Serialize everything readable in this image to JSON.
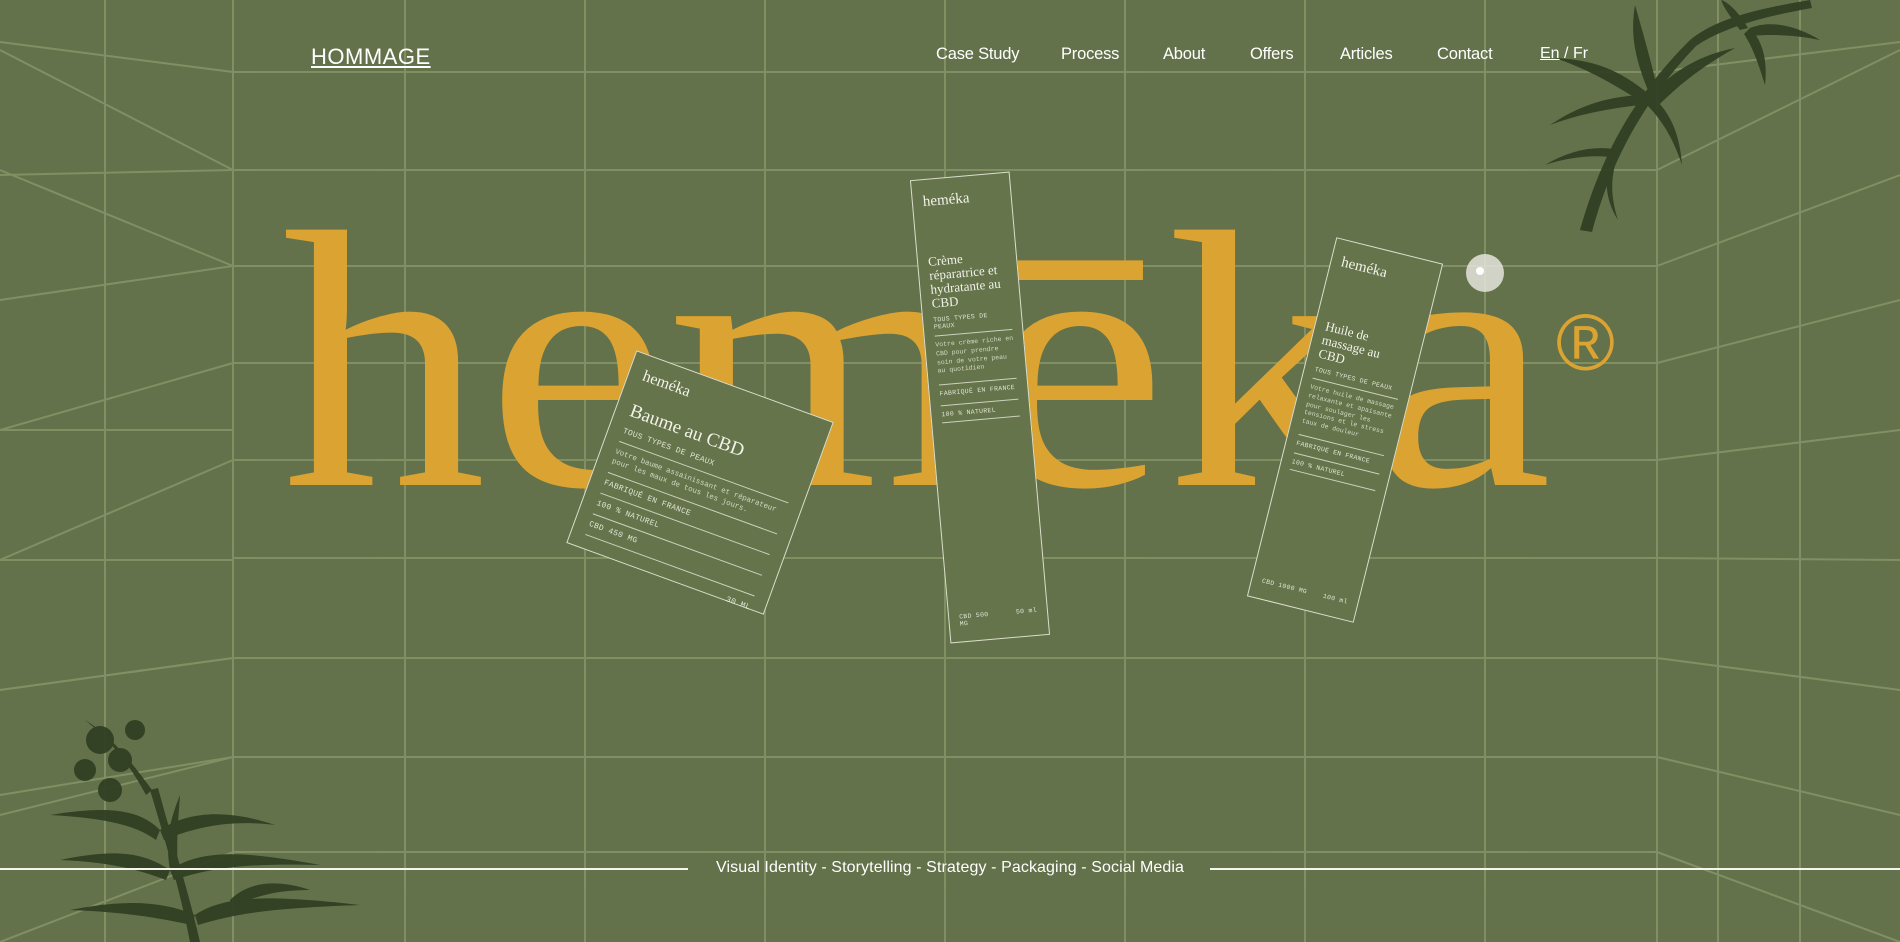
{
  "header": {
    "logo": "HOMMAGE",
    "nav": [
      {
        "label": "Case Study"
      },
      {
        "label": "Process"
      },
      {
        "label": "About"
      },
      {
        "label": "Offers"
      },
      {
        "label": "Articles"
      },
      {
        "label": "Contact"
      }
    ],
    "language": {
      "active": "En",
      "separator": "/",
      "other": "Fr"
    }
  },
  "hero": {
    "wordmark": "hemēka",
    "registered": "®",
    "accent_color": "#dba331",
    "background_color": "#63724a",
    "products": [
      {
        "brand": "heméka",
        "name": "Baume au CBD",
        "skin": "TOUS TYPES DE PEAUX",
        "description": "Votre baume assainissant et réparateur pour les maux de tous les jours.",
        "origin": "FABRIQUÉ EN FRANCE",
        "natural": "100 % NATUREL",
        "dose": "CBD 450 MG",
        "volume": "30 ML"
      },
      {
        "brand": "heméka",
        "name": "Crème réparatrice et hydratante au CBD",
        "skin": "TOUS TYPES DE PEAUX",
        "description": "Votre crème riche en CBD pour prendre soin de votre peau au quotidien",
        "origin": "FABRIQUÉ EN FRANCE",
        "natural": "100 % NATUREL",
        "dose": "CBD 500 MG",
        "volume": "50 ml"
      },
      {
        "brand": "heméka",
        "name": "Huile de massage au CBD",
        "skin": "TOUS TYPES DE PEAUX",
        "description": "Votre huile de massage relaxante et apaisante pour soulager les tensions et le stress taux de douleur",
        "origin": "FABRIQUÉ EN FRANCE",
        "natural": "100 % NATUREL",
        "dose": "CBD 1000 MG",
        "volume": "100 ml"
      }
    ]
  },
  "footer": {
    "tagline": "Visual Identity - Storytelling - Strategy - Packaging - Social Media"
  },
  "icons": [
    "cannabis-leaf-icon",
    "cursor-dot-icon"
  ]
}
